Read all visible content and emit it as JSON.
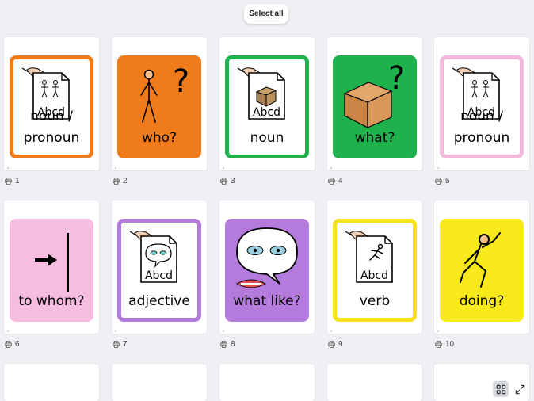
{
  "toolbar": {
    "select_all_label": "Select all"
  },
  "cards": [
    {
      "number": "1",
      "lines": [
        "noun /",
        "pronoun"
      ],
      "border": "#f07b1a",
      "style": "framed",
      "symbol": "people-doc-icon"
    },
    {
      "number": "2",
      "lines": [
        "who?"
      ],
      "fill": "#f07b1a",
      "style": "solid",
      "symbol": "person-question-icon"
    },
    {
      "number": "3",
      "lines": [
        "noun"
      ],
      "border": "#1fb14b",
      "style": "framed",
      "symbol": "box-doc-icon"
    },
    {
      "number": "4",
      "lines": [
        "what?"
      ],
      "fill": "#1fb14b",
      "style": "solid",
      "symbol": "box-question-icon"
    },
    {
      "number": "5",
      "lines": [
        "noun /",
        "pronoun"
      ],
      "border": "#f3b8dd",
      "style": "framed",
      "symbol": "people-doc-icon"
    },
    {
      "number": "6",
      "lines": [
        "to whom?"
      ],
      "fill": "#f7bde0",
      "style": "solid",
      "symbol": "arrow-to-line-icon"
    },
    {
      "number": "7",
      "lines": [
        "adjective"
      ],
      "border": "#b57bdc",
      "style": "framed",
      "symbol": "eyes-doc-icon"
    },
    {
      "number": "8",
      "lines": [
        "what like?"
      ],
      "fill": "#b57bdc",
      "style": "solid",
      "symbol": "speech-face-icon"
    },
    {
      "number": "9",
      "lines": [
        "verb"
      ],
      "border": "#f5e01c",
      "style": "framed",
      "symbol": "runner-doc-icon"
    },
    {
      "number": "10",
      "lines": [
        "doing?"
      ],
      "fill": "#f8ea1a",
      "style": "solid",
      "symbol": "jumping-person-icon"
    }
  ],
  "doc_label": "Abcd"
}
